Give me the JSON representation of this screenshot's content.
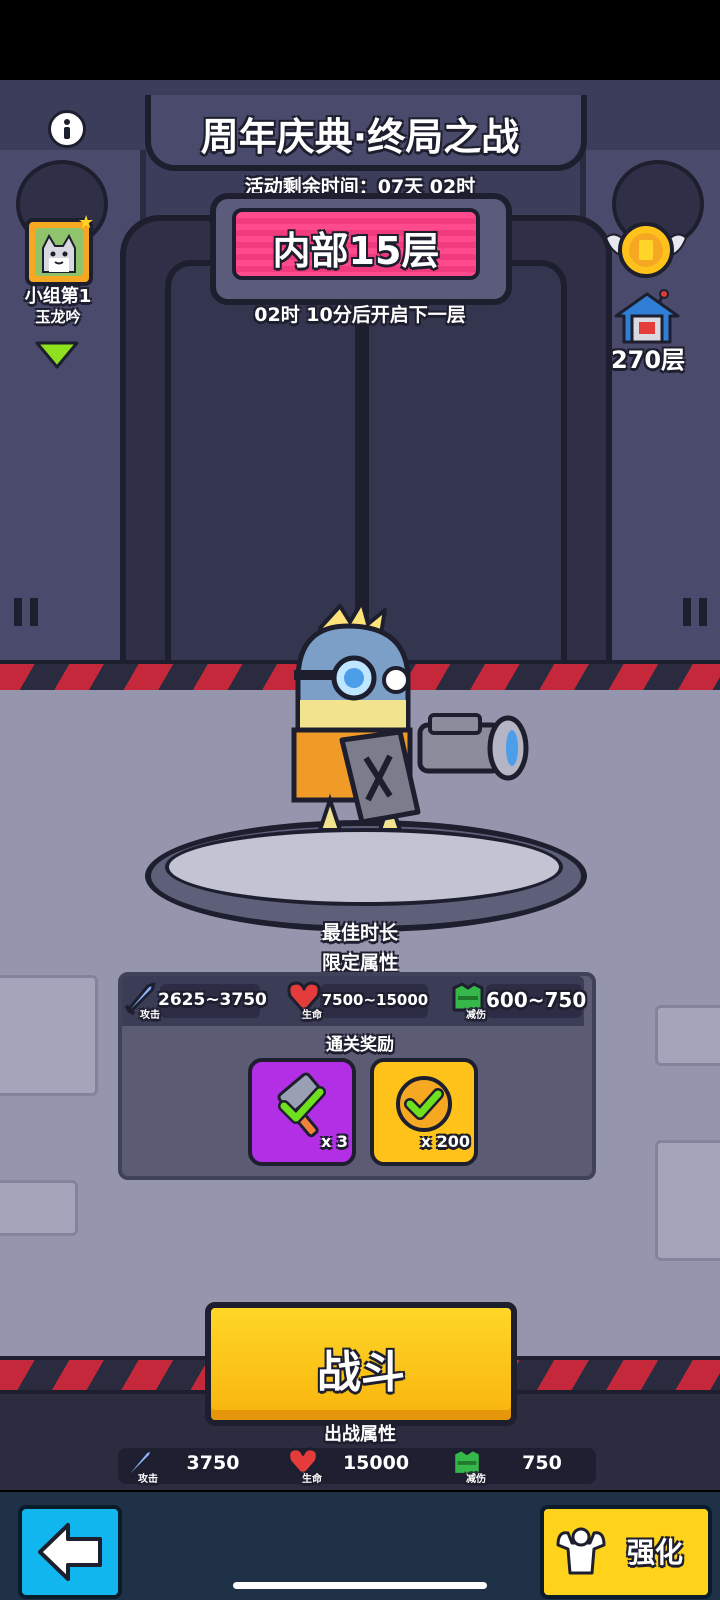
{
  "header": {
    "title": "周年庆典·终局之战",
    "countdown": "活动剩余时间：07天 02时",
    "floor_label": "内部15层",
    "next_floor_text": "02时 10分后开启下一层"
  },
  "left_panel": {
    "rank_label": "小组第1",
    "player_name": "玉龙吟"
  },
  "right_panel": {
    "total_floors": "270层"
  },
  "stage_info": {
    "best_time_label": "最佳时长",
    "limit_attr_label": "限定属性",
    "limit_attack": "2625~3750",
    "limit_attack_tag": "攻击",
    "limit_hp": "7500~15000",
    "limit_hp_tag": "生命",
    "limit_def": "600~750",
    "limit_def_tag": "减伤",
    "reward_label": "通关奖励",
    "rewards": [
      {
        "icon": "hammer-icon",
        "qty": "x 3",
        "color": "#b22fe6"
      },
      {
        "icon": "check-coin-icon",
        "qty": "x 200",
        "color": "#ffc21a"
      }
    ]
  },
  "fight": {
    "label": "战斗"
  },
  "battle_stats": {
    "label": "出战属性",
    "attack": "3750",
    "attack_tag": "攻击",
    "hp": "15000",
    "hp_tag": "生命",
    "def": "750",
    "def_tag": "减伤"
  },
  "nav": {
    "upgrade_label": "强化"
  },
  "colors": {
    "accent_pink": "#f03c7f",
    "fight_yellow": "#ffd628",
    "back_blue": "#12b6ee",
    "hazard_red": "#c5283a"
  }
}
